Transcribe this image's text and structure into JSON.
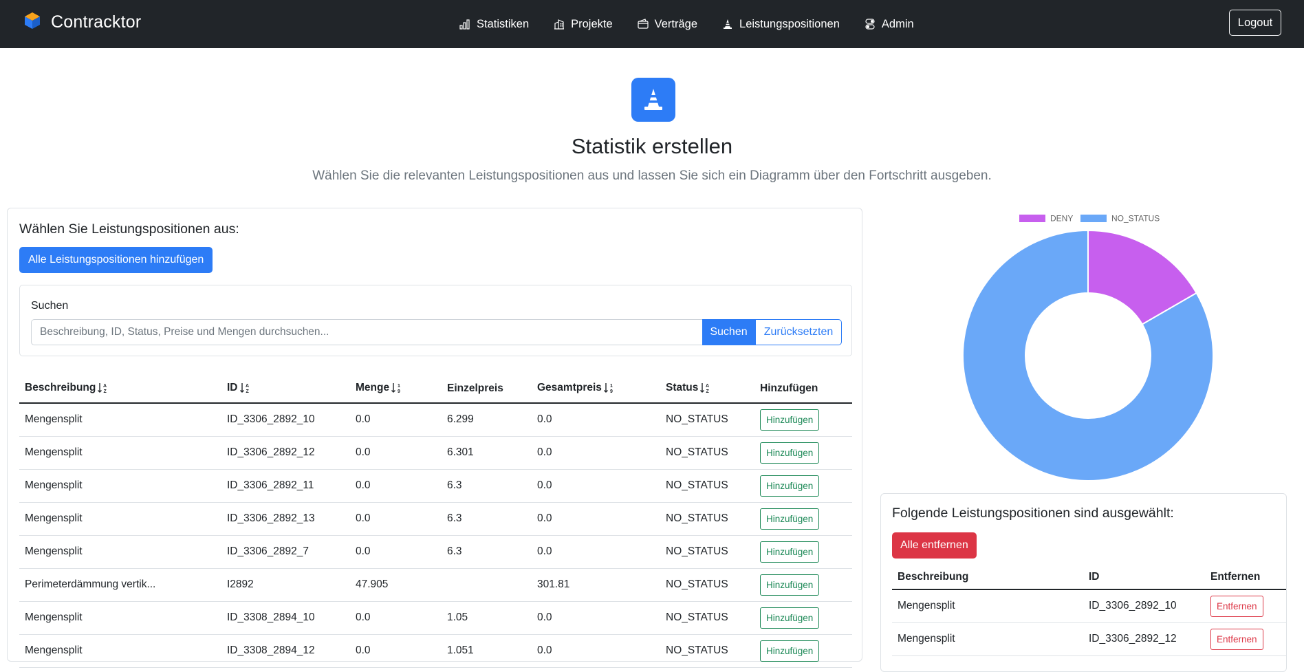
{
  "navbar": {
    "brand": "Contracktor",
    "links": [
      {
        "label": "Statistiken",
        "icon": "bar-chart-icon"
      },
      {
        "label": "Projekte",
        "icon": "building-icon"
      },
      {
        "label": "Verträge",
        "icon": "wallet-icon"
      },
      {
        "label": "Leistungspositionen",
        "icon": "cone-icon"
      },
      {
        "label": "Admin",
        "icon": "toggles-icon"
      }
    ],
    "logout": "Logout"
  },
  "header": {
    "icon": "traffic-cone-icon",
    "title": "Statistik erstellen",
    "subtitle": "Wählen Sie die relevanten Leistungspositionen aus und lassen Sie sich ein Diagramm über den Fortschritt ausgeben."
  },
  "colors": {
    "primary": "#2d7cf6",
    "danger": "#dc3545",
    "success": "#198754",
    "navbar": "#212529",
    "deny": "#c75fee",
    "no_status": "#6aa8f8"
  },
  "selection": {
    "title": "Wählen Sie Leistungspositionen aus:",
    "add_all_label": "Alle Leistungspositionen hinzufügen",
    "search": {
      "label": "Suchen",
      "placeholder": "Beschreibung, ID, Status, Preise und Mengen durchsuchen...",
      "value": "",
      "search_button": "Suchen",
      "reset_button": "Zurücksetzten"
    },
    "columns": [
      "Beschreibung",
      "ID",
      "Menge",
      "Einzelpreis",
      "Gesamtpreis",
      "Status",
      "Hinzufügen"
    ],
    "rows": [
      {
        "beschreibung": "Mengensplit",
        "id": "ID_3306_2892_10",
        "menge": "0.0",
        "einzelpreis": "6.299",
        "gesamtpreis": "0.0",
        "status": "NO_STATUS",
        "action": "Hinzufügen"
      },
      {
        "beschreibung": "Mengensplit",
        "id": "ID_3306_2892_12",
        "menge": "0.0",
        "einzelpreis": "6.301",
        "gesamtpreis": "0.0",
        "status": "NO_STATUS",
        "action": "Hinzufügen"
      },
      {
        "beschreibung": "Mengensplit",
        "id": "ID_3306_2892_11",
        "menge": "0.0",
        "einzelpreis": "6.3",
        "gesamtpreis": "0.0",
        "status": "NO_STATUS",
        "action": "Hinzufügen"
      },
      {
        "beschreibung": "Mengensplit",
        "id": "ID_3306_2892_13",
        "menge": "0.0",
        "einzelpreis": "6.3",
        "gesamtpreis": "0.0",
        "status": "NO_STATUS",
        "action": "Hinzufügen"
      },
      {
        "beschreibung": "Mengensplit",
        "id": "ID_3306_2892_7",
        "menge": "0.0",
        "einzelpreis": "6.3",
        "gesamtpreis": "0.0",
        "status": "NO_STATUS",
        "action": "Hinzufügen"
      },
      {
        "beschreibung": "Perimeterdämmung vertik...",
        "id": "I2892",
        "menge": "47.905",
        "einzelpreis": "",
        "gesamtpreis": "301.81",
        "status": "NO_STATUS",
        "action": "Hinzufügen"
      },
      {
        "beschreibung": "Mengensplit",
        "id": "ID_3308_2894_10",
        "menge": "0.0",
        "einzelpreis": "1.05",
        "gesamtpreis": "0.0",
        "status": "NO_STATUS",
        "action": "Hinzufügen"
      },
      {
        "beschreibung": "Mengensplit",
        "id": "ID_3308_2894_12",
        "menge": "0.0",
        "einzelpreis": "1.051",
        "gesamtpreis": "0.0",
        "status": "NO_STATUS",
        "action": "Hinzufügen"
      }
    ]
  },
  "chart_data": {
    "type": "pie",
    "donut": true,
    "categories": [
      "DENY",
      "NO_STATUS"
    ],
    "values": [
      1,
      5
    ],
    "legend_position": "top"
  },
  "selected": {
    "title": "Folgende Leistungspositionen sind ausgewählt:",
    "remove_all_label": "Alle entfernen",
    "columns": [
      "Beschreibung",
      "ID",
      "Entfernen"
    ],
    "rows": [
      {
        "beschreibung": "Mengensplit",
        "id": "ID_3306_2892_10",
        "action": "Entfernen"
      },
      {
        "beschreibung": "Mengensplit",
        "id": "ID_3306_2892_12",
        "action": "Entfernen"
      }
    ]
  }
}
